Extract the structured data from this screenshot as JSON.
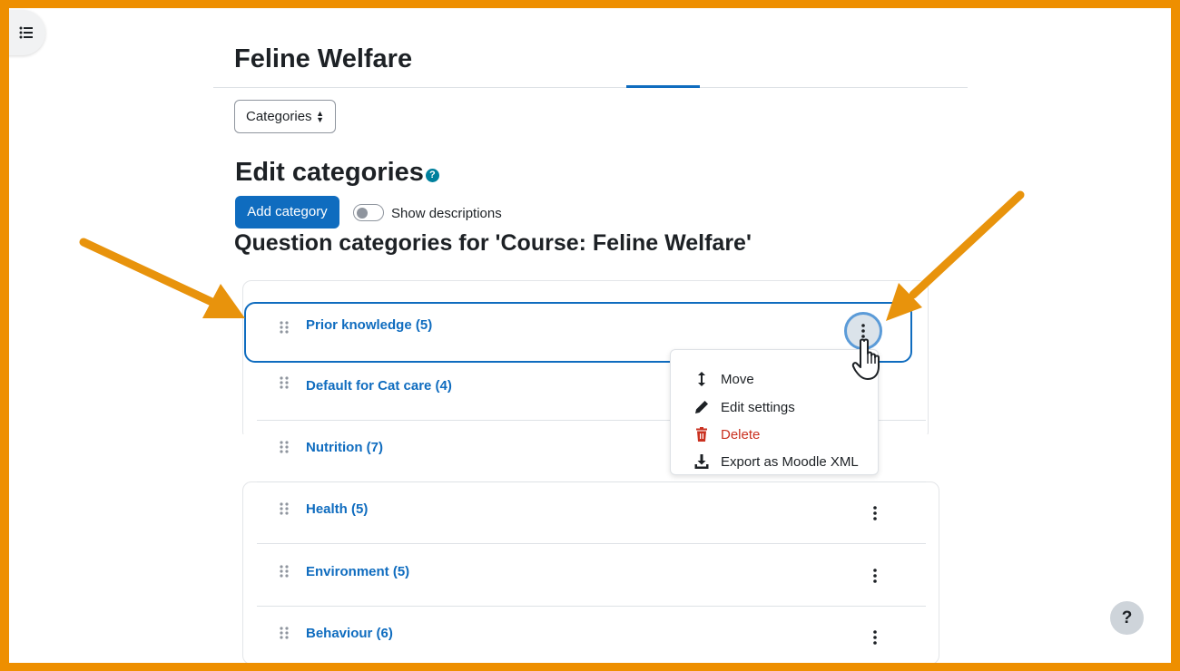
{
  "page": {
    "title": "Feline Welfare"
  },
  "nav": {
    "select_value": "Categories"
  },
  "edit": {
    "heading": "Edit categories",
    "help_glyph": "?",
    "add_button": "Add category",
    "toggle_label": "Show descriptions",
    "toggle_on": false
  },
  "list": {
    "heading": "Question categories for 'Course: Feline Welfare'",
    "items": [
      {
        "label": "Prior knowledge (5)",
        "active": true
      },
      {
        "label": "Default for Cat care (4)"
      },
      {
        "label": "Nutrition (7)"
      },
      {
        "label": "Health (5)"
      },
      {
        "label": "Environment (5)"
      },
      {
        "label": "Behaviour (6)"
      }
    ]
  },
  "menu": {
    "items": [
      {
        "label": "Move",
        "icon": "move-vertical-icon"
      },
      {
        "label": "Edit settings",
        "icon": "pencil-icon"
      },
      {
        "label": "Delete",
        "icon": "trash-icon",
        "danger": true
      },
      {
        "label": "Export as Moodle XML",
        "icon": "download-icon"
      }
    ]
  },
  "help_button": "?",
  "colors": {
    "frame": "#ee8f00",
    "link": "#0f6cbf",
    "primary": "#0f6cbf",
    "danger": "#ca3120",
    "annotation_arrow": "#e8930c"
  }
}
